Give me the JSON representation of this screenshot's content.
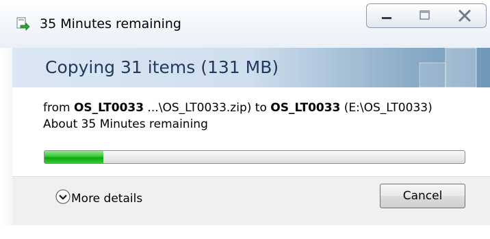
{
  "window": {
    "title": "35 Minutes remaining",
    "controls": [
      "minimize",
      "maximize",
      "close"
    ]
  },
  "header": {
    "title": "Copying 31 items (131 MB)"
  },
  "details": {
    "from_prefix": "from",
    "from_name": "OS_LT0033",
    "from_path": "...\\OS_LT0033.zip)",
    "to_prefix": "to",
    "to_name": "OS_LT0033",
    "to_path": "(E:\\OS_LT0033)",
    "time_remaining": "About 35 Minutes remaining"
  },
  "progress": {
    "fraction": 0.14,
    "color": "#22b822"
  },
  "footer": {
    "more_details_label": "More details",
    "cancel_label": "Cancel"
  },
  "icons": {
    "app": "copy-transfer-icon",
    "expand": "chevron-down-circle-icon"
  }
}
